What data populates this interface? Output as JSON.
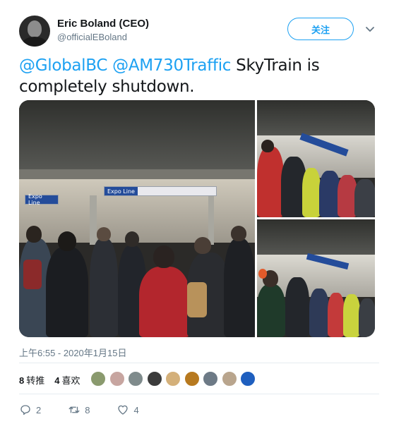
{
  "author": {
    "name": "Eric Boland (CEO)",
    "handle": "@officialEBoland",
    "avatar_icon": "profile-photo"
  },
  "follow_label": "关注",
  "tweet": {
    "mention1": "@GlobalBC",
    "mention2": "@AM730Traffic",
    "text_tail": "SkyTrain is completely shutdown."
  },
  "media": {
    "sign_line": "Expo Line",
    "sign_secondary": "Expo Line"
  },
  "timestamp": "上午6:55 - 2020年1月15日",
  "stats": {
    "retweets_count": "8",
    "retweets_label": "转推",
    "likes_count": "4",
    "likes_label": "喜欢"
  },
  "likers": [
    {
      "color": "#8a9a6e"
    },
    {
      "color": "#c7a5a0"
    },
    {
      "color": "#7f8b8c"
    },
    {
      "color": "#3b3b3b"
    },
    {
      "color": "#d4b07a"
    },
    {
      "color": "#b7791f"
    },
    {
      "color": "#6d7a86"
    },
    {
      "color": "#b9a58d"
    },
    {
      "color": "#1f5fbf"
    }
  ],
  "actions": {
    "reply_count": "2",
    "retweet_count": "8",
    "like_count": "4"
  },
  "colors": {
    "accent": "#1da1f2",
    "muted": "#657786",
    "text": "#14171a",
    "divider": "#e6ecf0"
  }
}
